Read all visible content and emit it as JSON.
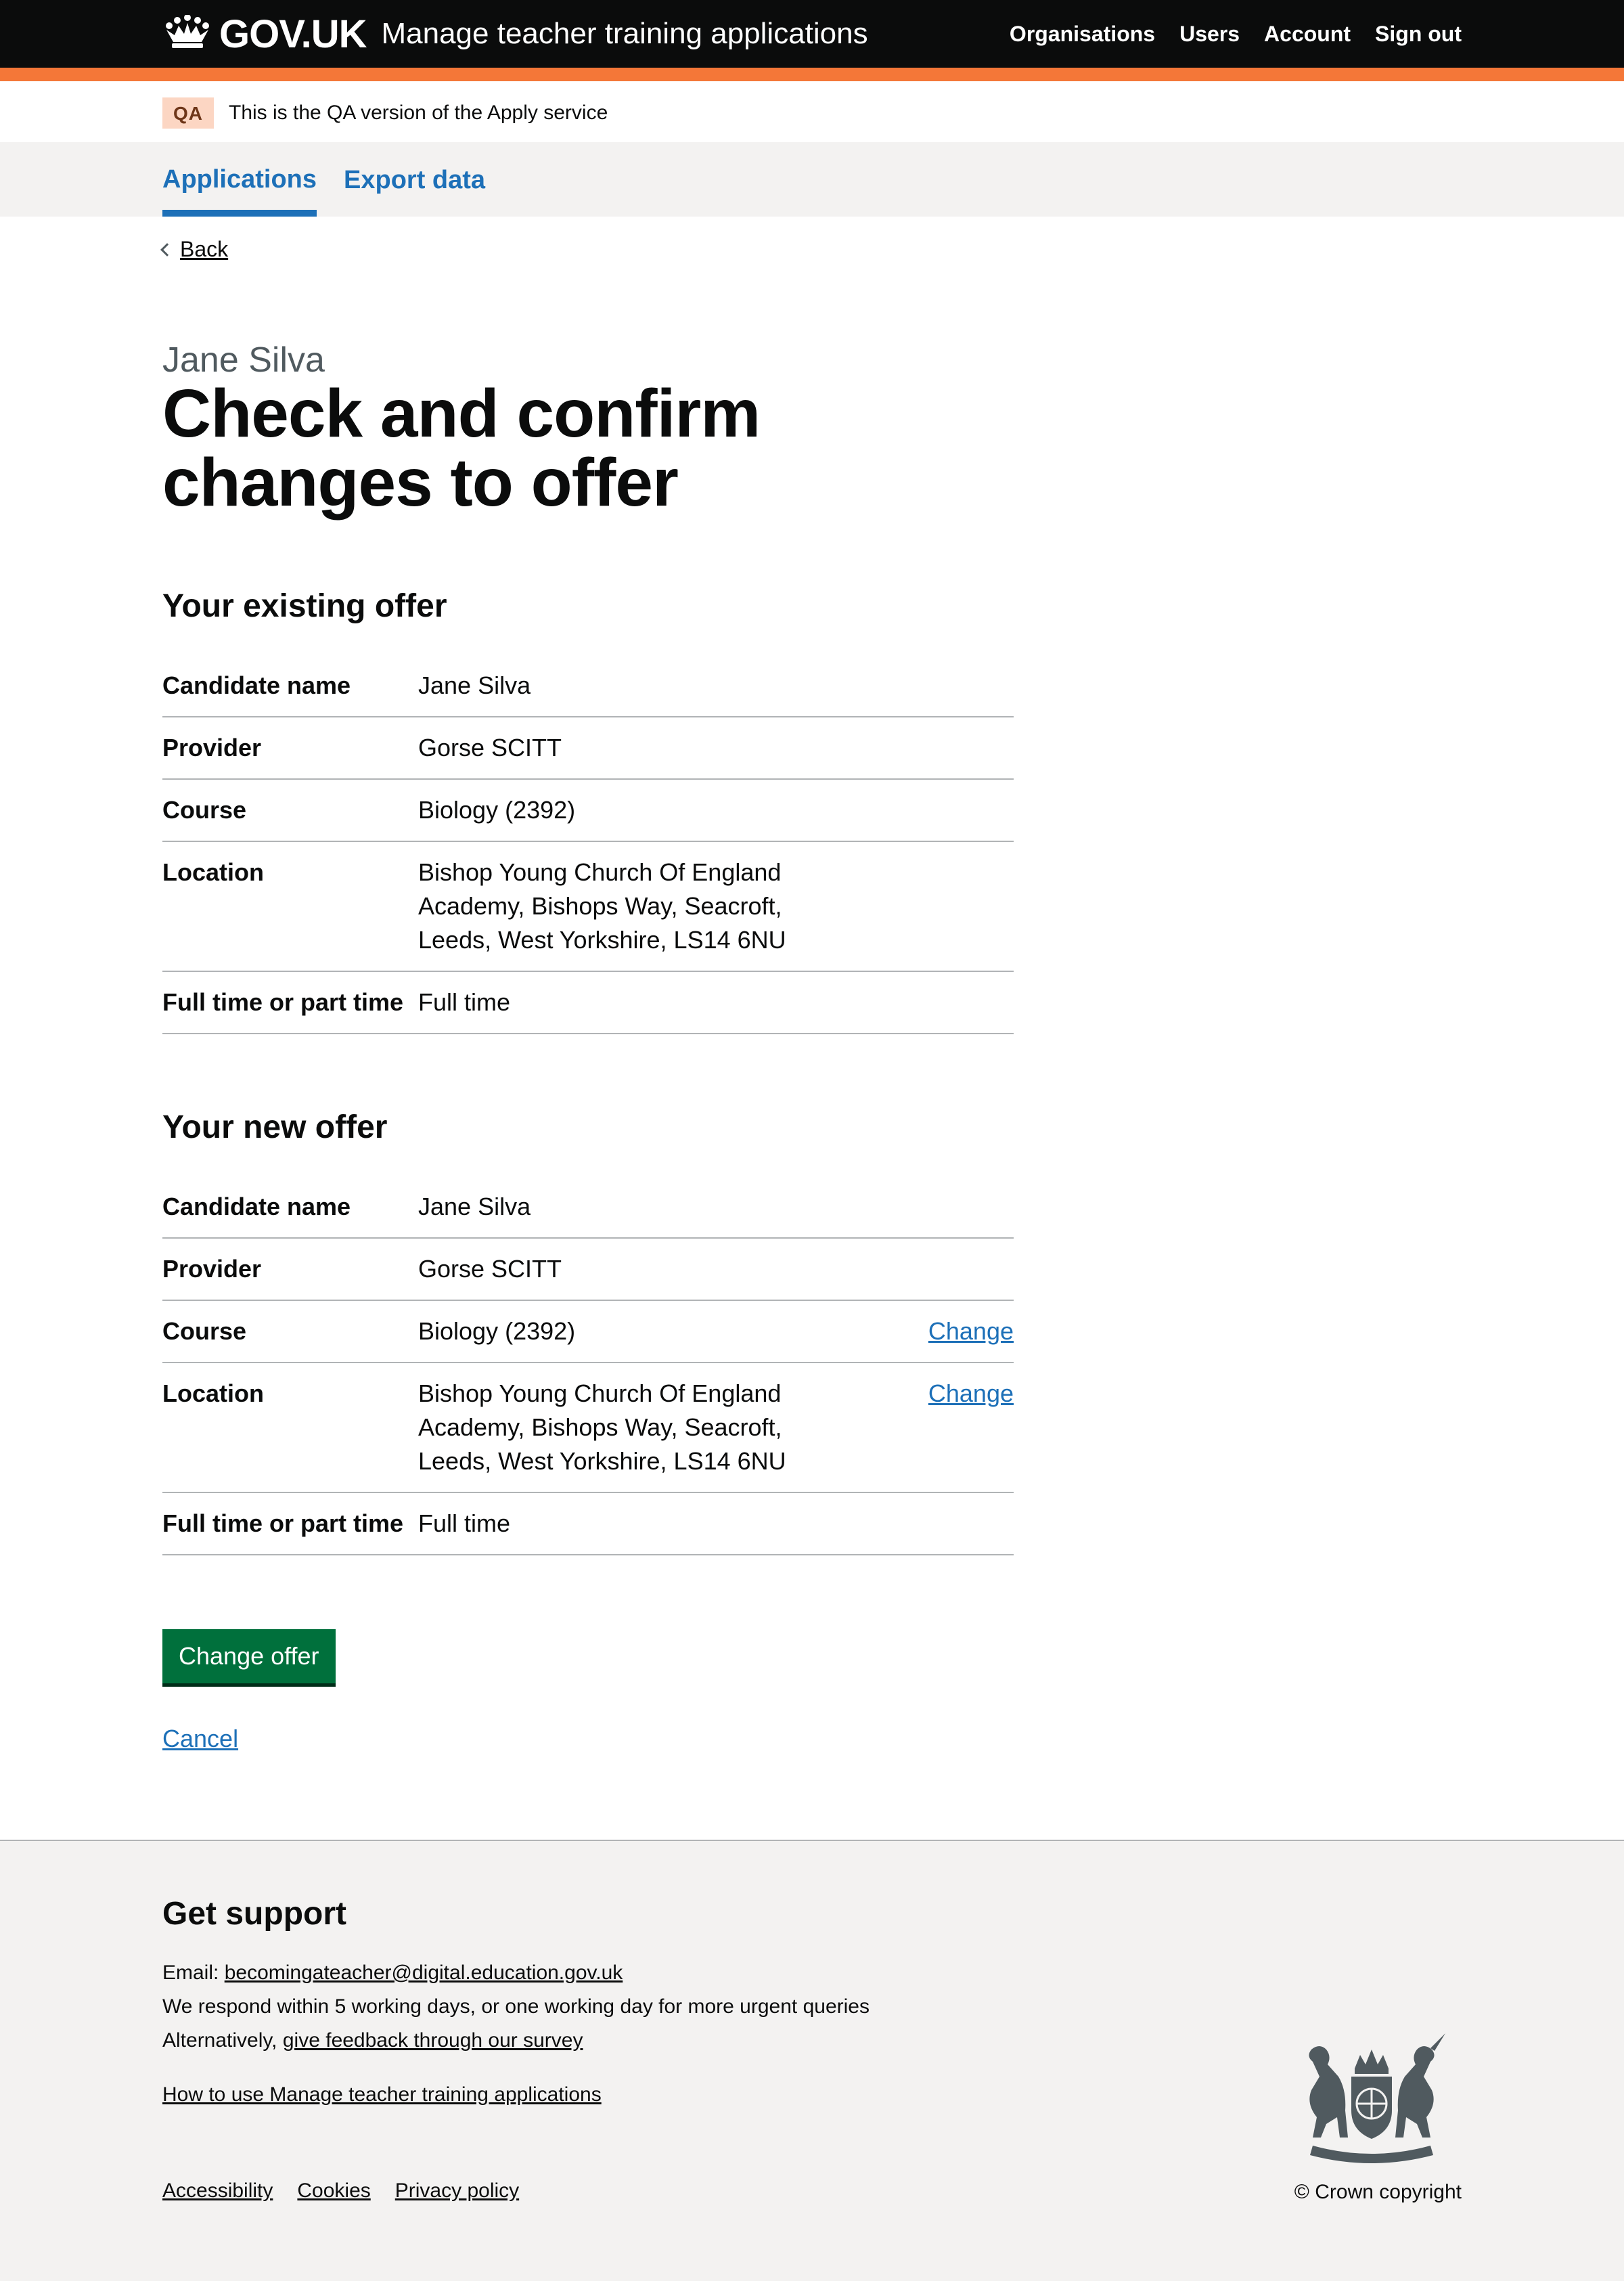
{
  "header": {
    "logo_text": "GOV.UK",
    "service_name": "Manage teacher training applications",
    "nav": [
      "Organisations",
      "Users",
      "Account",
      "Sign out"
    ]
  },
  "phase_banner": {
    "tag": "QA",
    "text": "This is the QA version of the Apply service"
  },
  "primary_nav": {
    "items": [
      "Applications",
      "Export data"
    ],
    "active": "Applications"
  },
  "back_link": "Back",
  "caption": "Jane Silva",
  "title": "Check and confirm changes to offer",
  "existing_offer": {
    "heading": "Your existing offer",
    "rows": [
      {
        "key": "Candidate name",
        "value": "Jane Silva"
      },
      {
        "key": "Provider",
        "value": "Gorse SCITT"
      },
      {
        "key": "Course",
        "value": "Biology (2392)"
      },
      {
        "key": "Location",
        "value": "Bishop Young Church Of England Academy, Bishops Way, Seacroft, Leeds, West Yorkshire, LS14 6NU"
      },
      {
        "key": "Full time or part time",
        "value": "Full time"
      }
    ]
  },
  "new_offer": {
    "heading": "Your new offer",
    "rows": [
      {
        "key": "Candidate name",
        "value": "Jane Silva"
      },
      {
        "key": "Provider",
        "value": "Gorse SCITT"
      },
      {
        "key": "Course",
        "value": "Biology (2392)",
        "action": "Change"
      },
      {
        "key": "Location",
        "value": "Bishop Young Church Of England Academy, Bishops Way, Seacroft, Leeds, West Yorkshire, LS14 6NU",
        "action": "Change"
      },
      {
        "key": "Full time or part time",
        "value": "Full time"
      }
    ]
  },
  "submit_button": "Change offer",
  "cancel_link": "Cancel",
  "footer": {
    "heading": "Get support",
    "email_label": "Email:",
    "email": "becomingateacher@digital.education.gov.uk",
    "response_text": "We respond within 5 working days, or one working day for more urgent queries",
    "alt_prefix": "Alternatively,",
    "survey_link": "give feedback through our survey",
    "how_to_link": "How to use Manage teacher training applications",
    "links": [
      "Accessibility",
      "Cookies",
      "Privacy policy"
    ],
    "copyright": "© Crown copyright"
  },
  "colors": {
    "header_bg": "#0b0c0c",
    "header_stripe": "#f47738",
    "link": "#1d70b8",
    "button": "#00703c",
    "footer_bg": "#f3f2f1"
  }
}
